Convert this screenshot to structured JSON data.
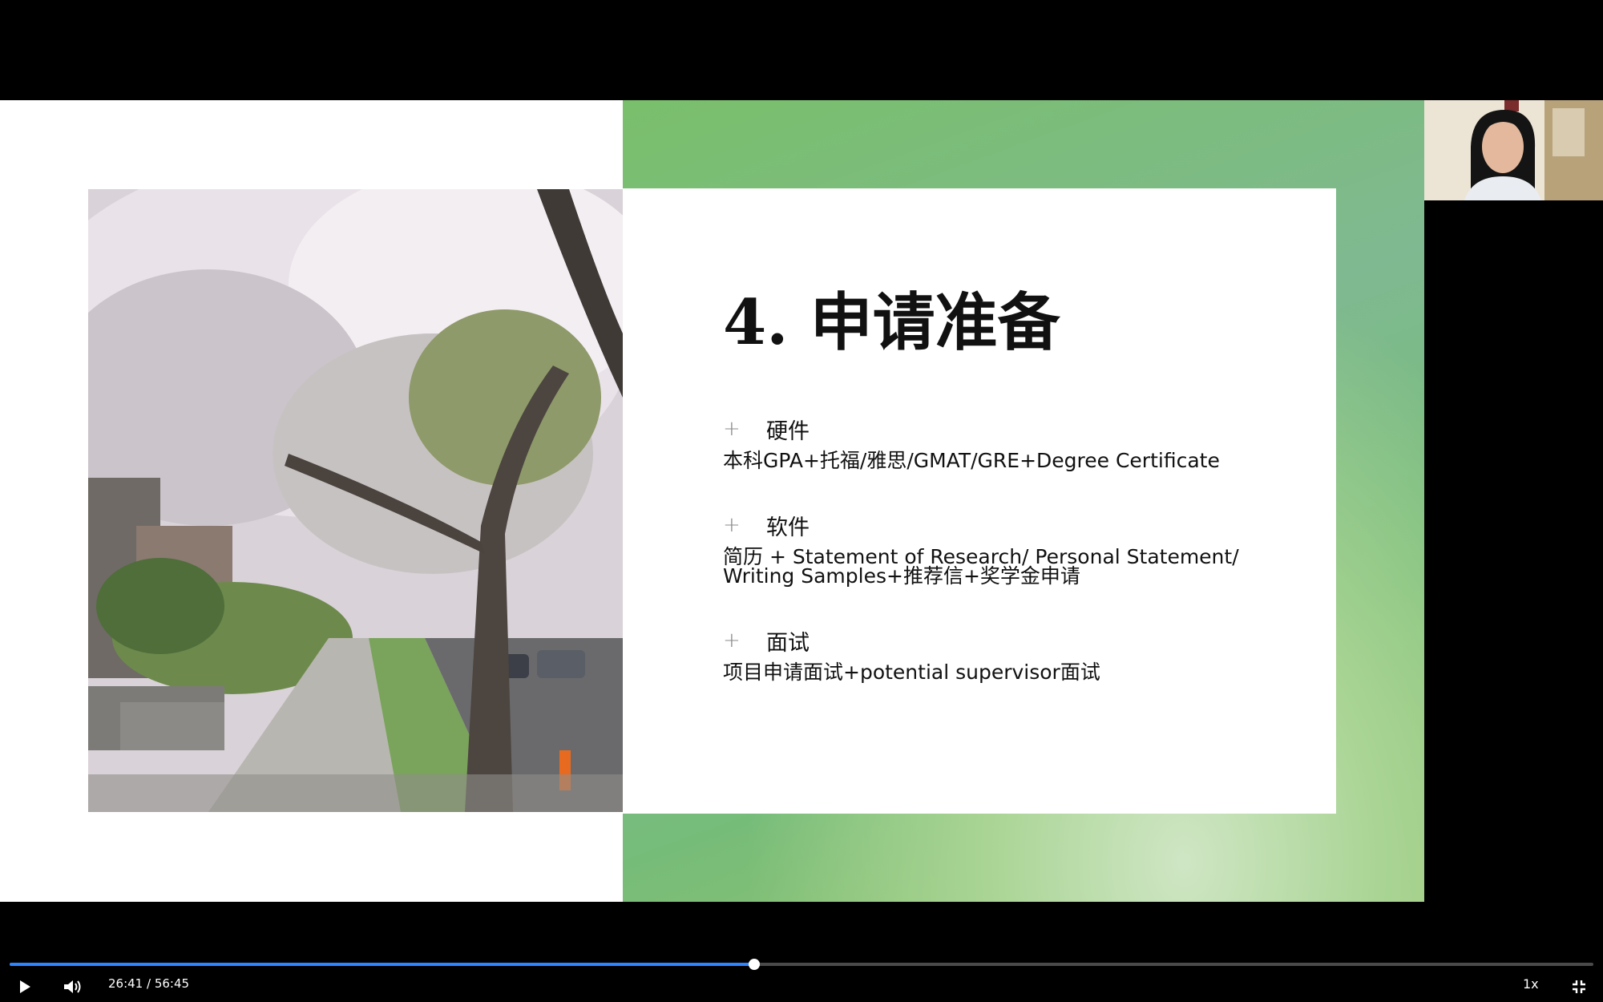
{
  "slide": {
    "title": "4. 申请准备",
    "sections": [
      {
        "marker": "+",
        "title": "硬件",
        "body": "本科GPA+托福/雅思/GMAT/GRE+Degree Certificate"
      },
      {
        "marker": "+",
        "title": "软件",
        "body_line1": "简历 + Statement of Research/ Personal Statement/",
        "body_line2": "Writing Samples+推荐信+奖学金申请"
      },
      {
        "marker": "+",
        "title": "面试",
        "body": "项目申请面试+potential supervisor面试"
      }
    ]
  },
  "slide_nav_icons": [
    "arrow-left-icon",
    "pen-icon",
    "pointer-icon",
    "more-icon",
    "arrow-right-icon"
  ],
  "player": {
    "current_time": "26:41",
    "separator": " / ",
    "total_time": "56:45",
    "progress_fraction": 0.47,
    "speed": "1x",
    "accent_color": "#2f84ff"
  }
}
